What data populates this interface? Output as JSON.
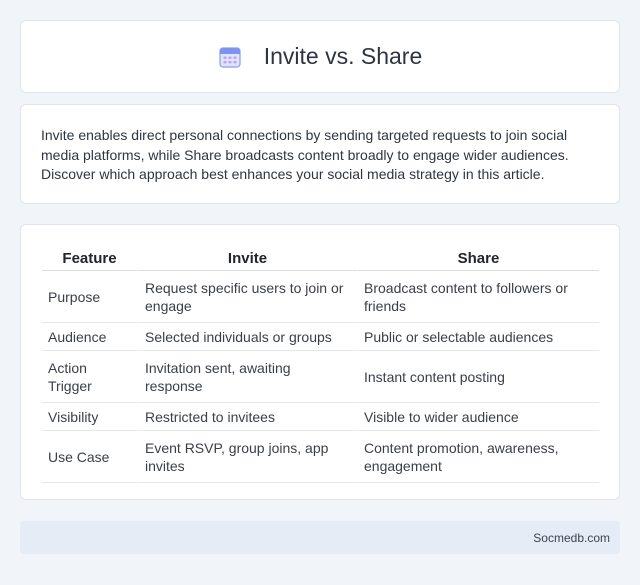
{
  "header": {
    "icon": "calendar-icon",
    "title": "Invite vs. Share"
  },
  "intro": {
    "text": "Invite enables direct personal connections by sending targeted requests to join social media platforms, while Share broadcasts content broadly to engage wider audiences. Discover which approach best enhances your social media strategy in this article."
  },
  "table": {
    "headers": [
      "Feature",
      "Invite",
      "Share"
    ],
    "rows": [
      [
        "Purpose",
        "Request specific users to join or engage",
        "Broadcast content to followers or friends"
      ],
      [
        "Audience",
        "Selected individuals or groups",
        "Public or selectable audiences"
      ],
      [
        "Action Trigger",
        "Invitation sent, awaiting response",
        "Instant content posting"
      ],
      [
        "Visibility",
        "Restricted to invitees",
        "Visible to wider audience"
      ],
      [
        "Use Case",
        "Event RSVP, group joins, app invites",
        "Content promotion, awareness, engagement"
      ]
    ]
  },
  "footer": {
    "text": "Socmedb.com"
  },
  "colors": {
    "background": "#f1f4f9",
    "card": "#ffffff",
    "footer": "#e6ecf6",
    "icon_accent": "#8a9cf0"
  }
}
